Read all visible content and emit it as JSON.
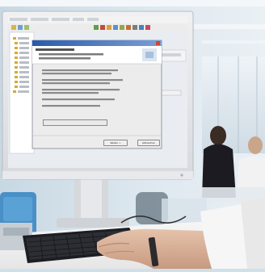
{
  "scene": {
    "description_free": true,
    "wizard": {
      "title": "",
      "next_label": "Weiter >",
      "cancel_label": "Abbrechen",
      "check_button_label": ""
    }
  },
  "colors": {
    "sky_top": "#eef4f8",
    "screen_bg": "#dfe6ee",
    "wizard_header": "#1f4f98",
    "desk": "#f3f3f3",
    "keyboard": "#1c1d21",
    "monitor_bezel": "#e3e5e8"
  }
}
